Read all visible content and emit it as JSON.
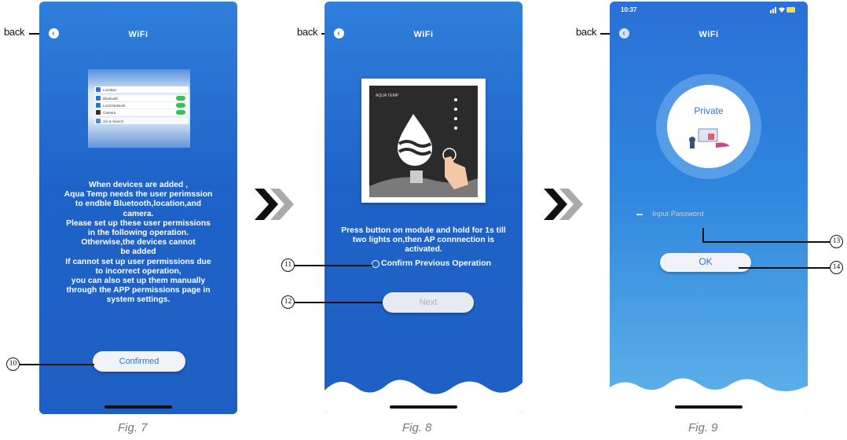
{
  "back_label": "back",
  "screen_title": "WiFi",
  "fig7": {
    "caption": "Fig. 7",
    "settings_rows": [
      "Location",
      "Bluetooth",
      "Local Network",
      "Camera",
      "Siri & Search"
    ],
    "message": "When devices are added ,\nAqua Temp needs the user perimssion\nto endble Bluetooth,location,and\ncamera.\nPlease set up these user permissions\nin the following operation.\nOtherwise,the devices cannot\nbe added\nIf cannot set up user permissions due\nto incorrect operation,\nyou can also set up them manually\nthrough the APP permissions page in\nsystem settings.",
    "confirm_button": "Confirmed",
    "callout": "10"
  },
  "fig8": {
    "caption": "Fig. 8",
    "module_brand": "AQUA TEMP",
    "instruction": "Press button on module and hold for 1s till\ntwo lights on,then AP connnection is\nactivated.",
    "confirm_option": "Confirm Previous Operation",
    "next_button": "Next",
    "callouts": [
      "11",
      "12"
    ]
  },
  "fig9": {
    "caption": "Fig. 9",
    "status_time": "10:37",
    "private_label": "Private",
    "password_placeholder": "Input Password",
    "ok_button": "OK",
    "callouts": [
      "13",
      "14"
    ]
  },
  "colors": {
    "phone_blue": "#1f63c8",
    "button_text": "#2a7ad8",
    "toggle_green": "#39c05b"
  },
  "icons": [
    "back-arrow-icon",
    "chevron-double-right-icon",
    "wifi-signal-icon",
    "battery-icon",
    "water-drop-icon",
    "finger-press-icon",
    "qr-code-icon"
  ]
}
